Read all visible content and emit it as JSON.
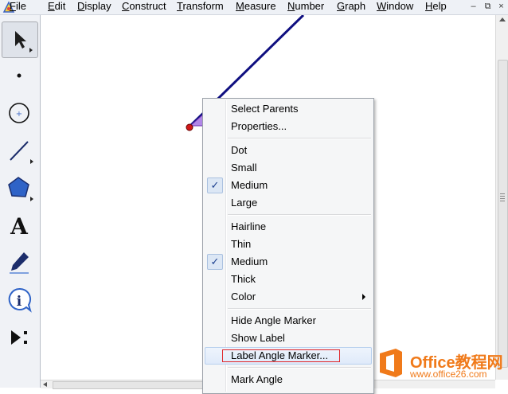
{
  "menubar": {
    "items": [
      {
        "text": "File",
        "u": "F",
        "rest": "ile"
      },
      {
        "text": "Edit",
        "u": "E",
        "rest": "dit"
      },
      {
        "text": "Display",
        "u": "D",
        "rest": "isplay"
      },
      {
        "text": "Construct",
        "u": "C",
        "rest": "onstruct"
      },
      {
        "text": "Transform",
        "u": "T",
        "rest": "ransform"
      },
      {
        "text": "Measure",
        "u": "M",
        "rest": "easure"
      },
      {
        "text": "Number",
        "u": "N",
        "rest": "umber"
      },
      {
        "text": "Graph",
        "u": "G",
        "rest": "raph"
      },
      {
        "text": "Window",
        "u": "W",
        "rest": "indow"
      },
      {
        "text": "Help",
        "u": "H",
        "rest": "elp"
      }
    ],
    "window_buttons": [
      "–",
      "⧉",
      "×"
    ]
  },
  "toolbox": {
    "tools": [
      "arrow-select-tool",
      "point-tool",
      "compass-tool",
      "straightedge-tool",
      "polygon-tool",
      "text-tool",
      "marker-tool",
      "information-tool",
      "custom-tool"
    ],
    "text_tool_glyph": "A",
    "info_tool_glyph": "i"
  },
  "context_menu": {
    "items": [
      {
        "label": "Select Parents",
        "checked": false
      },
      {
        "label": "Properties...",
        "checked": false
      },
      {
        "label": "Dot",
        "checked": false
      },
      {
        "label": "Small",
        "checked": false
      },
      {
        "label": "Medium",
        "checked": true
      },
      {
        "label": "Large",
        "checked": false
      },
      {
        "label": "Hairline",
        "checked": false
      },
      {
        "label": "Thin",
        "checked": false
      },
      {
        "label": "Medium",
        "checked": true
      },
      {
        "label": "Thick",
        "checked": false
      },
      {
        "label": "Color",
        "checked": false,
        "submenu": true
      },
      {
        "label": "Hide Angle Marker",
        "checked": false
      },
      {
        "label": "Show Label",
        "checked": false
      },
      {
        "label": "Label Angle Marker...",
        "checked": false,
        "highlighted": true
      },
      {
        "label": "Mark Angle",
        "checked": false
      }
    ],
    "check_glyph": "✓"
  },
  "watermark": {
    "title": "Office教程网",
    "url": "www.office26.com"
  },
  "colors": {
    "line": "#0f0f80",
    "angle_marker": "#b187e8",
    "point": "#d01818",
    "highlight_box": "#e0262a",
    "watermark": "#f07a1a"
  }
}
